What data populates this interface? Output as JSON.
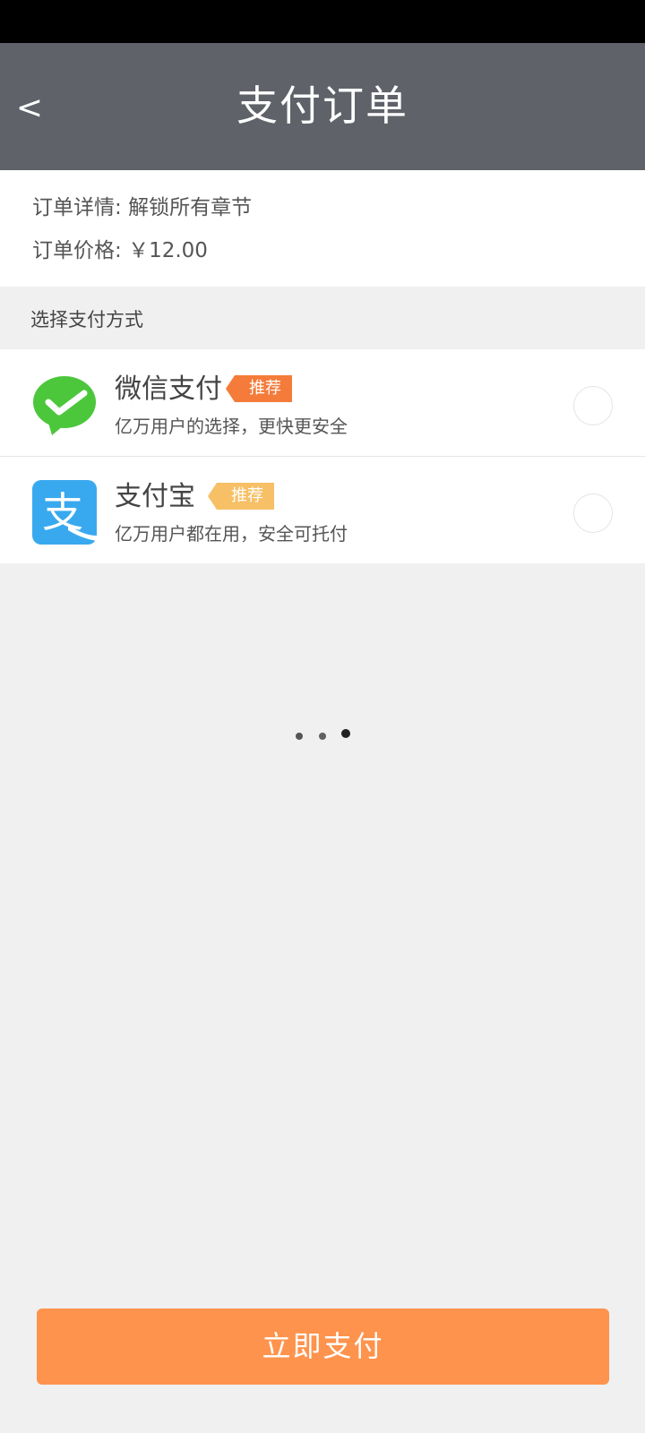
{
  "header": {
    "back_label": "<",
    "title": "支付订单"
  },
  "order": {
    "detail_label": "订单详情:",
    "detail_value": "解锁所有章节",
    "price_label": "订单价格:",
    "price_value": "￥12.00"
  },
  "payment": {
    "section_label": "选择支付方式",
    "methods": [
      {
        "name": "微信支付",
        "badge": "推荐",
        "description": "亿万用户的选择，更快更安全",
        "icon": "wechat-pay-icon",
        "color": "#4cc73c"
      },
      {
        "name": "支付宝",
        "badge": "推荐",
        "description": "亿万用户都在用，安全可托付",
        "icon": "alipay-icon",
        "glyph": "支",
        "color": "#39a9ef"
      }
    ]
  },
  "footer": {
    "pay_button_label": "立即支付"
  },
  "colors": {
    "header_bg": "#5f6369",
    "accent": "#fe934d",
    "badge_primary": "#f47b3a",
    "badge_secondary": "#f7c066"
  }
}
